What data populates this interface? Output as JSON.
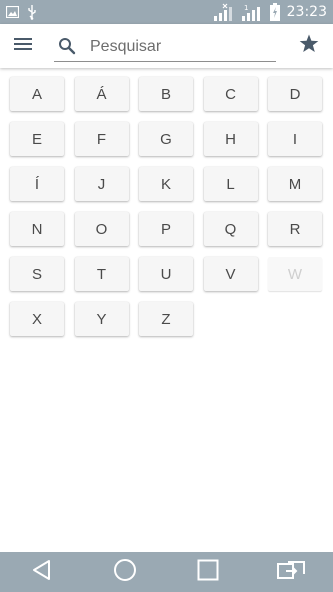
{
  "status_bar": {
    "time": "23:23",
    "icons": [
      "image-icon",
      "usb-icon",
      "signal-icon",
      "signal-icon",
      "battery-icon"
    ]
  },
  "toolbar": {
    "menu_icon": "menu-icon",
    "search_icon": "search-icon",
    "search_placeholder": "Pesquisar",
    "favorite_icon": "star-icon"
  },
  "letters": [
    "A",
    "Á",
    "B",
    "C",
    "D",
    "E",
    "F",
    "G",
    "H",
    "I",
    "Í",
    "J",
    "K",
    "L",
    "M",
    "N",
    "O",
    "P",
    "Q",
    "R",
    "S",
    "T",
    "U",
    "V",
    "W",
    "X",
    "Y",
    "Z"
  ],
  "nav_bar": {
    "icons": [
      "back-icon",
      "home-icon",
      "recents-icon",
      "switch-sim-icon"
    ]
  },
  "colors": {
    "system_bars": "#9aa9b3",
    "accent": "#4a5a6a"
  }
}
